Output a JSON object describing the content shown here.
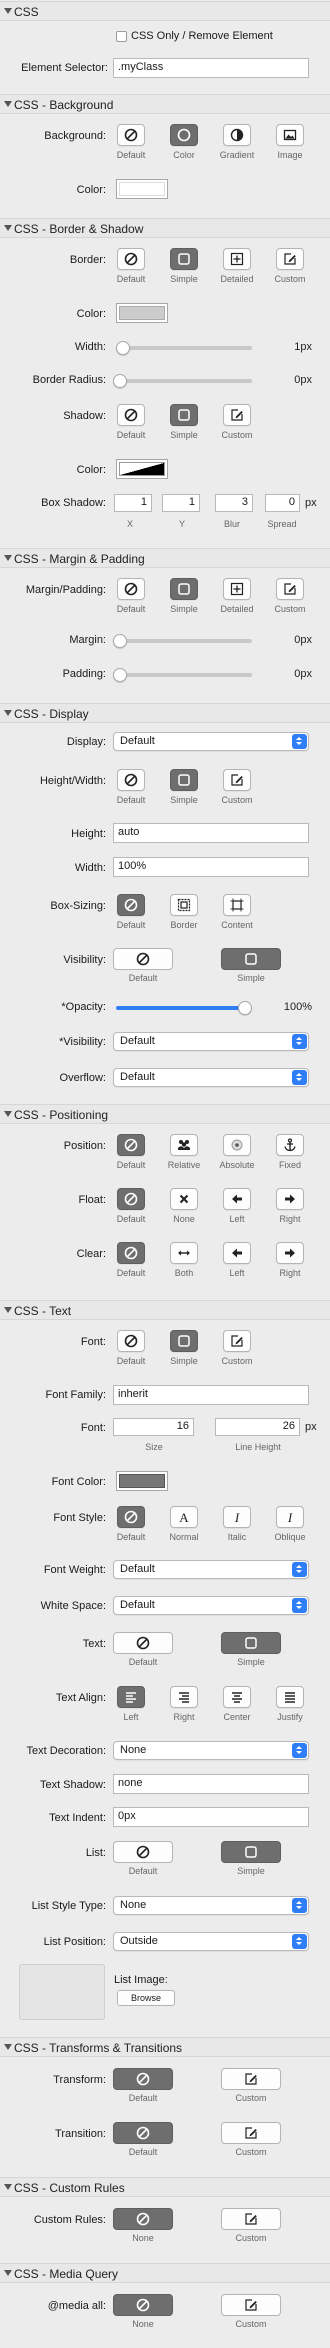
{
  "css": {
    "title": "CSS",
    "only_label": "CSS Only / Remove Element",
    "selector_label": "Element Selector:",
    "selector_value": ".myClass"
  },
  "bg": {
    "title": "CSS - Background",
    "label": "Background:",
    "options": [
      "Default",
      "Color",
      "Gradient",
      "Image"
    ],
    "color_label": "Color:"
  },
  "border": {
    "title": "CSS - Border & Shadow",
    "label": "Border:",
    "options": [
      "Default",
      "Simple",
      "Detailed",
      "Custom"
    ],
    "color_label": "Color:",
    "width_label": "Width:",
    "width_value": "1px",
    "radius_label": "Border Radius:",
    "radius_value": "0px",
    "shadow_label": "Shadow:",
    "shadow_options": [
      "Default",
      "Simple",
      "Custom"
    ],
    "shadow_color_label": "Color:",
    "box_shadow_label": "Box Shadow:",
    "box_shadow": {
      "x": "1",
      "y": "1",
      "blur": "3",
      "spread": "0",
      "unit": "px"
    },
    "box_shadow_caps": [
      "X",
      "Y",
      "Blur",
      "Spread"
    ]
  },
  "margin": {
    "title": "CSS - Margin & Padding",
    "label": "Margin/Padding:",
    "options": [
      "Default",
      "Simple",
      "Detailed",
      "Custom"
    ],
    "margin_label": "Margin:",
    "margin_value": "0px",
    "padding_label": "Padding:",
    "padding_value": "0px"
  },
  "display": {
    "title": "CSS - Display",
    "display_label": "Display:",
    "display_value": "Default",
    "hw_label": "Height/Width:",
    "hw_options": [
      "Default",
      "Simple",
      "Custom"
    ],
    "height_label": "Height:",
    "height_value": "auto",
    "width_label": "Width:",
    "width_value": "100%",
    "boxsizing_label": "Box-Sizing:",
    "boxsizing_options": [
      "Default",
      "Border",
      "Content"
    ],
    "visibility_label": "Visibility:",
    "visibility_options": [
      "Default",
      "Simple"
    ],
    "opacity_label": "*Opacity:",
    "opacity_value": "100%",
    "opacity_level": 1.0,
    "visibility2_label": "*Visibility:",
    "visibility2_value": "Default",
    "overflow_label": "Overflow:",
    "overflow_value": "Default"
  },
  "position": {
    "title": "CSS - Positioning",
    "label": "Position:",
    "options": [
      "Default",
      "Relative",
      "Absolute",
      "Fixed"
    ],
    "float_label": "Float:",
    "float_options": [
      "Default",
      "None",
      "Left",
      "Right"
    ],
    "clear_label": "Clear:",
    "clear_options": [
      "Default",
      "Both",
      "Left",
      "Right"
    ]
  },
  "text": {
    "title": "CSS - Text",
    "font_label": "Font:",
    "font_options": [
      "Default",
      "Simple",
      "Custom"
    ],
    "family_label": "Font Family:",
    "family_value": "inherit",
    "size_label": "Font:",
    "size_value": "16",
    "line_value": "26",
    "size_unit": "px",
    "size_cap": "Size",
    "line_cap": "Line Height",
    "fcolor_label": "Font Color:",
    "style_label": "Font Style:",
    "style_options": [
      "Default",
      "Normal",
      "Italic",
      "Oblique"
    ],
    "weight_label": "Font Weight:",
    "weight_value": "Default",
    "white_label": "White Space:",
    "white_value": "Default",
    "text_label": "Text:",
    "text_options": [
      "Default",
      "Simple"
    ],
    "align_label": "Text Align:",
    "align_options": [
      "Left",
      "Right",
      "Center",
      "Justify"
    ],
    "deco_label": "Text Decoration:",
    "deco_value": "None",
    "shadow_label": "Text Shadow:",
    "shadow_value": "none",
    "indent_label": "Text Indent:",
    "indent_value": "0px",
    "list_label": "List:",
    "list_options": [
      "Default",
      "Simple"
    ],
    "lst_label": "List Style Type:",
    "lst_value": "None",
    "lsp_label": "List Position:",
    "lsp_value": "Outside",
    "img_label": "List Image:",
    "browse_label": "Browse"
  },
  "trans": {
    "title": "CSS - Transforms & Transitions",
    "transform_label": "Transform:",
    "transition_label": "Transition:",
    "options": [
      "Default",
      "Custom"
    ]
  },
  "custom": {
    "title": "CSS - Custom Rules",
    "label": "Custom Rules:",
    "options": [
      "None",
      "Custom"
    ]
  },
  "media": {
    "title": "CSS - Media Query",
    "label": "@media all:",
    "options": [
      "None",
      "Custom"
    ]
  },
  "colors": {
    "accent": "#2f7ef5",
    "selected": "#6e6e6e",
    "border_color": "#cccccc",
    "shadow_color": "#000000",
    "font_color": "#777777"
  }
}
